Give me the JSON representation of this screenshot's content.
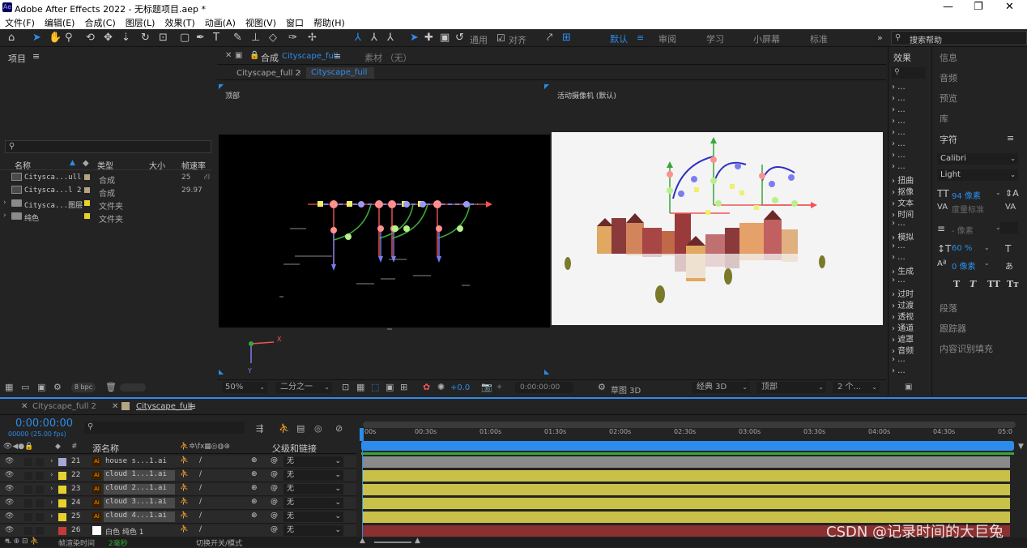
{
  "app": {
    "title": "Adobe After Effects 2022 - 无标题项目.aep *",
    "logo": "Ae"
  },
  "window_controls": {
    "minimize": "—",
    "restore": "❐",
    "close": "✕"
  },
  "menu": [
    "文件(F)",
    "编辑(E)",
    "合成(C)",
    "图层(L)",
    "效果(T)",
    "动画(A)",
    "视图(V)",
    "窗口",
    "帮助(H)"
  ],
  "toolbar": {
    "tools": [
      "home-icon",
      "selection-icon",
      "hand-icon",
      "zoom-icon",
      "orbit-icon",
      "pan-icon",
      "dolly-icon",
      "rotate-icon",
      "anchor-icon",
      "rect-icon",
      "pen-icon",
      "text-icon",
      "brush-icon",
      "clone-icon",
      "eraser-icon",
      "roto-icon",
      "puppet-icon"
    ],
    "universal_label": "通用",
    "snap_label": "对齐",
    "workspaces": [
      "默认",
      "审阅",
      "学习",
      "小屏幕",
      "标准"
    ],
    "active_workspace": "默认",
    "search_placeholder": "搜索帮助"
  },
  "project": {
    "title": "项目",
    "search_placeholder": "",
    "columns": [
      "名称",
      "类型",
      "大小",
      "帧速率"
    ],
    "items": [
      {
        "name": "Cityscа...ull",
        "type": "合成",
        "fps": "25",
        "color": "#b5a482"
      },
      {
        "name": "Cityscа...l 2",
        "type": "合成",
        "fps": "29.97",
        "color": "#b5a482"
      },
      {
        "name": "Cityscа...图层",
        "type": "文件夹",
        "fps": "",
        "color": "#e6d22e"
      },
      {
        "name": "纯色",
        "type": "文件夹",
        "fps": "",
        "color": "#e6d22e"
      }
    ],
    "bpc": "8 bpc"
  },
  "comp_viewer": {
    "tab_label": "合成",
    "tab_comp": "Cityscape_full",
    "footage_tab": "素材 （无）",
    "breadcrumbs": [
      "Cityscape_full 2",
      "Cityscape_full"
    ],
    "left_view_label": "顶部",
    "right_view_label": "活动摄像机 (默认)",
    "zoom": "50%",
    "resolution": "二分之一",
    "exposure": "+0.0",
    "timecode": "0:00:00:00",
    "renderer": "草图 3D",
    "classic": "经典 3D",
    "view": "顶部",
    "views_count": "2 个..."
  },
  "effects_panel": {
    "title": "效果",
    "items": [
      "扭曲",
      "抠像",
      "文本",
      "时间",
      "模拟",
      "生成",
      "过时",
      "过渡",
      "透视",
      "通道",
      "遮罩",
      "音频"
    ]
  },
  "right_panels": {
    "items": [
      "信息",
      "音频",
      "预览",
      "库"
    ],
    "character": "字符",
    "font": "Calibri",
    "style": "Light",
    "size": "94 像素",
    "tracking_label": "度量标准",
    "leading": "- 像素",
    "vscale": "60 %",
    "baseline": "0 像素",
    "format_buttons": [
      "T",
      "T",
      "TT",
      "Tт"
    ],
    "lower": [
      "段落",
      "跟踪器",
      "内容识别填充"
    ]
  },
  "timeline": {
    "tabs": [
      "Cityscape_full 2",
      "Cityscape_full"
    ],
    "active_tab": "Cityscape_full",
    "timecode": "0:00:00:00",
    "fps_info": "00000 (25.00 fps)",
    "columns": {
      "source": "源名称",
      "parent": "父级和链接"
    },
    "ticks": [
      "00s",
      "00:30s",
      "01:00s",
      "01:30s",
      "02:00s",
      "02:30s",
      "03:00s",
      "03:30s",
      "04:00s",
      "04:30s",
      "05:0"
    ],
    "layers": [
      {
        "num": "21",
        "name": "house s...1.ai",
        "parent": "无",
        "color": "#a7a8d6",
        "bar": "#8a8a8a"
      },
      {
        "num": "22",
        "name": "cloud 1...1.ai",
        "parent": "无",
        "color": "#e6d22e",
        "bar": "#c9c04a"
      },
      {
        "num": "23",
        "name": "cloud 2...1.ai",
        "parent": "无",
        "color": "#e6d22e",
        "bar": "#c9c04a"
      },
      {
        "num": "24",
        "name": "cloud 3...1.ai",
        "parent": "无",
        "color": "#e6d22e",
        "bar": "#c9c04a"
      },
      {
        "num": "25",
        "name": "cloud 4...1.ai",
        "parent": "无",
        "color": "#e6d22e",
        "bar": "#c9c04a"
      },
      {
        "num": "26",
        "name": "白色 纯色 1",
        "parent": "无",
        "color": "#c23a3a",
        "bar": "#8a3030"
      }
    ],
    "footer": {
      "render_label": "帧渲染时间",
      "render_time": "2毫秒",
      "toggle_label": "切换开关/模式"
    }
  },
  "watermark": "CSDN @记录时间的大巨兔"
}
